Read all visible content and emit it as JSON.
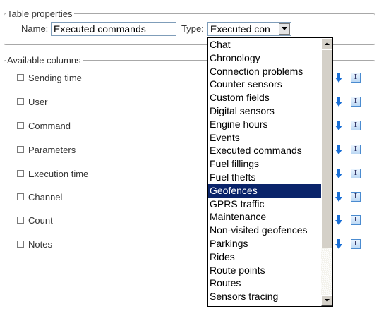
{
  "table_properties": {
    "legend": "Table properties",
    "name_label": "Name:",
    "name_value": "Executed commands",
    "type_label": "Type:",
    "type_value": "Executed con"
  },
  "available_columns": {
    "legend": "Available columns",
    "rows": [
      {
        "label": "Sending time"
      },
      {
        "label": "User"
      },
      {
        "label": "Command"
      },
      {
        "label": "Parameters"
      },
      {
        "label": "Execution time"
      },
      {
        "label": "Channel"
      },
      {
        "label": "Count"
      },
      {
        "label": "Notes"
      }
    ],
    "info_icon_glyph": "I"
  },
  "type_dropdown": {
    "options": [
      "Chat",
      "Chronology",
      "Connection problems",
      "Counter sensors",
      "Custom fields",
      "Digital sensors",
      "Engine hours",
      "Events",
      "Executed commands",
      "Fuel fillings",
      "Fuel thefts",
      "Geofences",
      "GPRS traffic",
      "Maintenance",
      "Non-visited geofences",
      "Parkings",
      "Rides",
      "Route points",
      "Routes",
      "Sensors tracing"
    ],
    "selected": "Geofences"
  },
  "colors": {
    "selection_bg": "#0a246a",
    "arrow_blue": "#1a6fd6",
    "border": "#a8a8a8"
  }
}
